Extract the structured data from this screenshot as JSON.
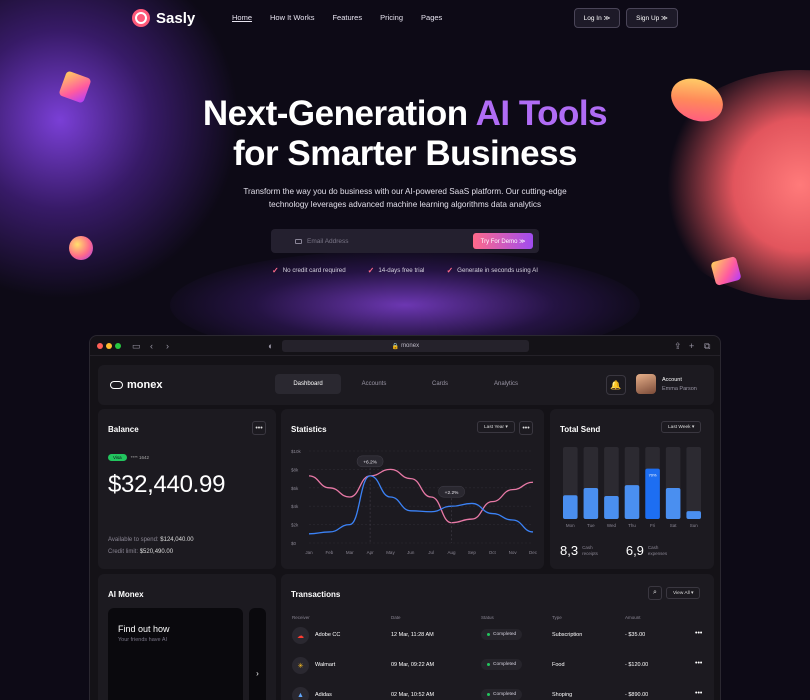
{
  "nav": {
    "brand": "Sasly",
    "menu": [
      "Home",
      "How It Works",
      "Features",
      "Pricing",
      "Pages"
    ],
    "login": "Log In ≫",
    "signup": "Sign Up ≫"
  },
  "hero": {
    "title_a": "Next-Generation ",
    "title_hl": "AI Tools",
    "title_b": "for Smarter Business",
    "sub1": "Transform the way you do business with our AI-powered SaaS platform. Our cutting-edge",
    "sub2": "technology leverages advanced machine learning algorithms data analytics",
    "email_placeholder": "Email Address",
    "cta": "Try For Demo ≫",
    "checks": [
      "No credit card required",
      "14-days free trial",
      "Generate in seconds using AI"
    ]
  },
  "browser": {
    "url": "monex"
  },
  "app": {
    "brand": "monex",
    "tabs": [
      "Dashboard",
      "Accounts",
      "Cards",
      "Analytics"
    ],
    "account_label": "Account",
    "account_name": "Emma Parson",
    "accent": "#3b82f6",
    "accent_green": "#22c55e"
  },
  "balance": {
    "title": "Balance",
    "chip": "Visa",
    "card_mask": "**** 1642",
    "amount": "$32,440.99",
    "available_label": "Available to spend:",
    "available_value": "$124,040.00",
    "limit_label": "Credit limit:",
    "limit_value": "$520,490.00"
  },
  "statistics": {
    "title": "Statistics",
    "range": "Last Year ▾"
  },
  "total_send": {
    "title": "Total Send",
    "range": "Last Week ▾",
    "num1": "8,3",
    "num1_label_a": "Cash",
    "num1_label_b": "receipts",
    "num2": "6,9",
    "num2_label_a": "Cash",
    "num2_label_b": "expenses"
  },
  "ai_monex": {
    "title": "AI Monex",
    "card_title": "Find out how",
    "card_sub": "Your friends have AI",
    "arrow": "›"
  },
  "transactions": {
    "title": "Transactions",
    "view_all": "View All ▾",
    "headers": [
      "Receiver",
      "Date",
      "Status",
      "Type",
      "Amount"
    ],
    "rows": [
      {
        "name": "Adobe CC",
        "date": "12 Mar, 11:28 AM",
        "status": "Completed",
        "type": "Subscription",
        "amount": "- $35.00",
        "icon": "adobe-icon",
        "icon_color": "#ff3b30"
      },
      {
        "name": "Walmart",
        "date": "09 Mar, 09:22 AM",
        "status": "Completed",
        "type": "Food",
        "amount": "- $120.00",
        "icon": "walmart-icon",
        "icon_color": "#fbbf24"
      },
      {
        "name": "Adidas",
        "date": "02 Mar, 10:52 AM",
        "status": "Completed",
        "type": "Shoping",
        "amount": "- $890.00",
        "icon": "adidas-icon",
        "icon_color": "#60a5fa"
      }
    ]
  },
  "chart_data": [
    {
      "type": "line",
      "title": "Statistics",
      "x": [
        "Jan",
        "Feb",
        "Mar",
        "Apr",
        "May",
        "Jun",
        "Jul",
        "Aug",
        "Sep",
        "Oct",
        "Nov",
        "Dec"
      ],
      "yticks": [
        "$0",
        "$2k",
        "$4k",
        "$6k",
        "$8k",
        "$10k"
      ],
      "ylim": [
        0,
        10
      ],
      "series": [
        {
          "color": "#e879a6",
          "values": [
            7.3,
            6.0,
            5.0,
            7.3,
            8.0,
            7.0,
            5.0,
            2.2,
            2.6,
            4.5,
            5.8,
            6.6
          ]
        },
        {
          "color": "#3b82f6",
          "values": [
            1.0,
            1.2,
            2.0,
            7.3,
            5.0,
            3.5,
            3.4,
            4.0,
            4.3,
            3.2,
            2.5,
            1.2
          ]
        }
      ],
      "annotations": [
        {
          "x": "Apr",
          "label": "+6.2%"
        },
        {
          "x": "Aug",
          "label": "+2.2%"
        }
      ],
      "grid": true
    },
    {
      "type": "bar",
      "title": "Total Send",
      "categories": [
        "Mon",
        "Tue",
        "Wed",
        "Thu",
        "Fri",
        "Sat",
        "Sun"
      ],
      "values": [
        33,
        43,
        32,
        47,
        70,
        43,
        11
      ],
      "ylim": [
        0,
        100
      ],
      "highlight": "Fri",
      "highlight_label": "70%"
    }
  ]
}
